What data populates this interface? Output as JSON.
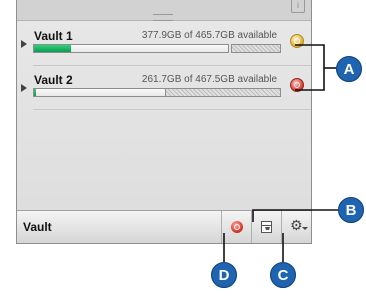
{
  "vaults": [
    {
      "name": "Vault 1",
      "capacity": "377.9GB of 465.7GB available",
      "used_fraction": 0.19,
      "status": "ok"
    },
    {
      "name": "Vault 2",
      "capacity": "261.7GB of 467.5GB available",
      "used_fraction": 0.01,
      "status": "error"
    }
  ],
  "bottom_bar": {
    "label": "Vault"
  },
  "callouts": {
    "a": "A",
    "b": "B",
    "c": "C",
    "d": "D"
  },
  "icons": {
    "status_ok": "vault-status-ok-icon",
    "status_error": "vault-status-error-icon",
    "sync": "sync-icon",
    "archive": "archive-icon",
    "gear": "gear-icon"
  },
  "colors": {
    "bar_fill": "#18b364",
    "callout": "#1f64b0",
    "error": "#d93a2f",
    "ok": "#e8b53e"
  }
}
